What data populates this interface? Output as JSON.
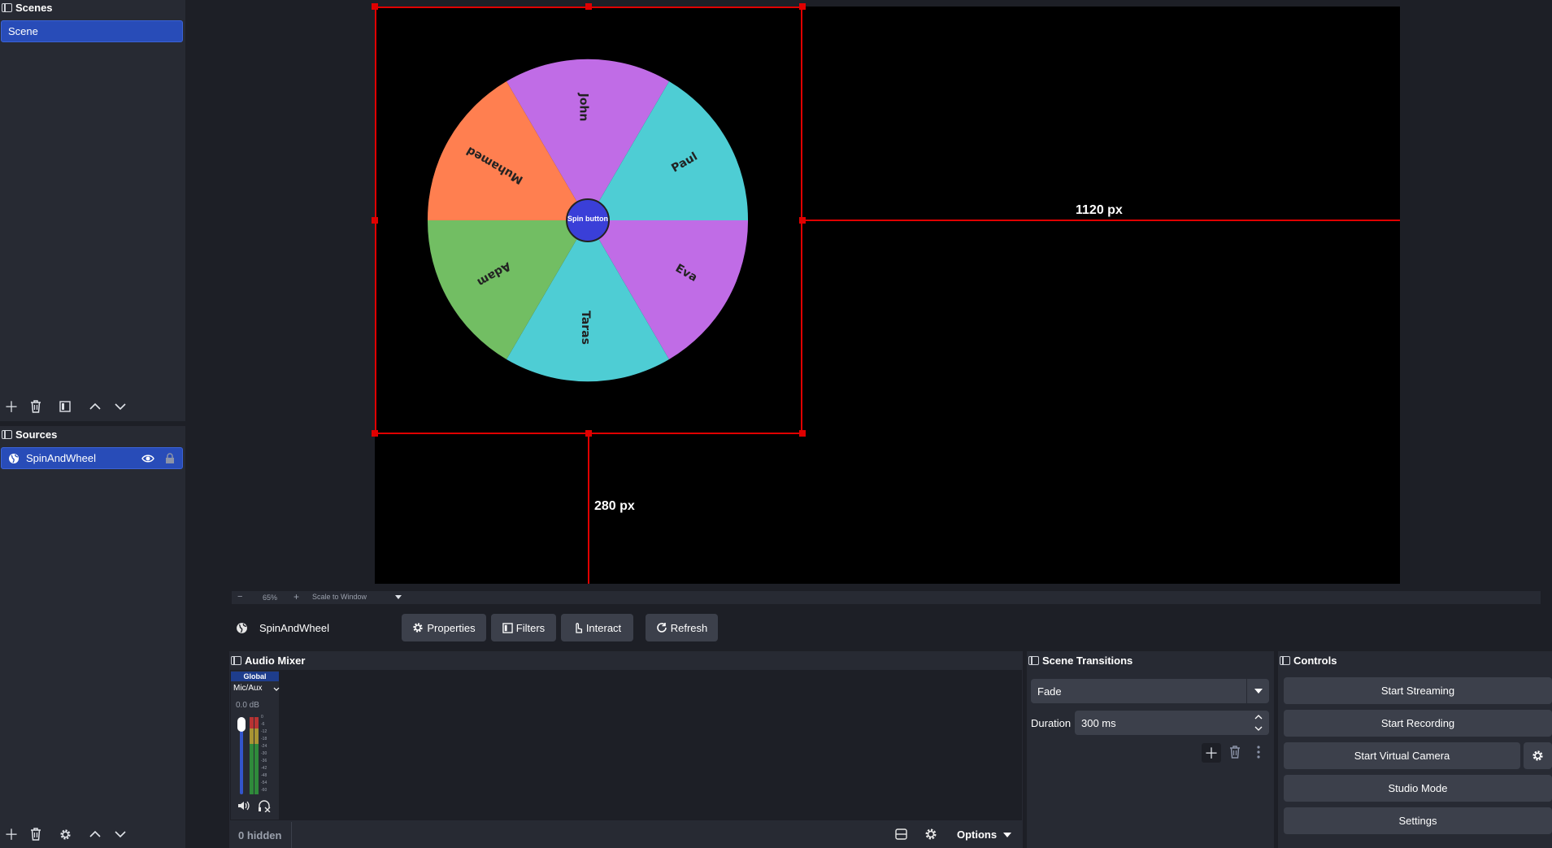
{
  "scenes": {
    "title": "Scenes",
    "items": [
      {
        "label": "Scene"
      }
    ]
  },
  "sources": {
    "title": "Sources",
    "items": [
      {
        "label": "SpinAndWheel"
      }
    ]
  },
  "preview": {
    "wheel_segments": [
      "John",
      "Paul",
      "Eva",
      "Taras",
      "Adam",
      "Muhamed"
    ],
    "spin_button_label": "Spin button",
    "horizontal_measure": "1120 px",
    "vertical_measure": "280 px",
    "colors": {
      "purple": "#c06ce6",
      "cyan": "#4ecdd4",
      "orange": "#ff7f50",
      "green": "#72be63",
      "spin": "#3a3fd8"
    }
  },
  "zoom_bar": {
    "zoom_minus": "−",
    "zoom_value": "65%",
    "zoom_plus": "+",
    "scale_mode": "Scale to Window"
  },
  "context_bar": {
    "source_name": "SpinAndWheel",
    "properties": "Properties",
    "filters": "Filters",
    "interact": "Interact",
    "refresh": "Refresh"
  },
  "audio_mixer": {
    "title": "Audio Mixer",
    "global_badge": "Global",
    "channel_name": "Mic/Aux",
    "db_value": "0.0 dB",
    "meter_ticks": [
      "0",
      "-6",
      "-12",
      "-18",
      "-24",
      "-30",
      "-36",
      "-42",
      "-48",
      "-54",
      "-60"
    ],
    "hidden_count": "0 hidden",
    "options": "Options"
  },
  "scene_transitions": {
    "title": "Scene Transitions",
    "transition": "Fade",
    "duration_label": "Duration",
    "duration_value": "300 ms"
  },
  "controls": {
    "title": "Controls",
    "start_streaming": "Start Streaming",
    "start_recording": "Start Recording",
    "start_virtual_camera": "Start Virtual Camera",
    "studio_mode": "Studio Mode",
    "settings": "Settings"
  }
}
